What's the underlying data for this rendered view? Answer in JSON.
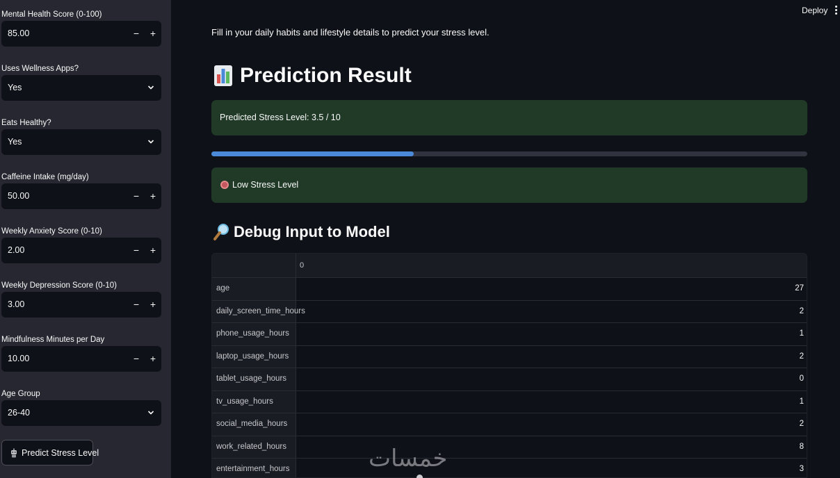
{
  "sidebar": {
    "mental_health": {
      "label": "Mental Health Score (0-100)",
      "value": "85.00"
    },
    "wellness_apps": {
      "label": "Uses Wellness Apps?",
      "value": "Yes"
    },
    "eats_healthy": {
      "label": "Eats Healthy?",
      "value": "Yes"
    },
    "caffeine": {
      "label": "Caffeine Intake (mg/day)",
      "value": "50.00"
    },
    "anxiety": {
      "label": "Weekly Anxiety Score (0-10)",
      "value": "2.00"
    },
    "depression": {
      "label": "Weekly Depression Score (0-10)",
      "value": "3.00"
    },
    "mindfulness": {
      "label": "Mindfulness Minutes per Day",
      "value": "10.00"
    },
    "age_group": {
      "label": "Age Group",
      "value": "26-40"
    },
    "stepper_minus": "−",
    "stepper_plus": "+",
    "predict_button": "Predict Stress Level"
  },
  "header": {
    "deploy": "Deploy"
  },
  "main": {
    "intro": "Fill in your daily habits and lifestyle details to predict your stress level.",
    "result_title": "Prediction Result",
    "predicted_text": "Predicted Stress Level: 3.5 / 10",
    "progress_fraction": 0.34,
    "stress_label": "Low Stress Level",
    "debug_title": "Debug Input to Model",
    "table": {
      "column": "0",
      "rows": [
        {
          "name": "age",
          "value": "27"
        },
        {
          "name": "daily_screen_time_hours",
          "value": "2"
        },
        {
          "name": "phone_usage_hours",
          "value": "1"
        },
        {
          "name": "laptop_usage_hours",
          "value": "2"
        },
        {
          "name": "tablet_usage_hours",
          "value": "0"
        },
        {
          "name": "tv_usage_hours",
          "value": "1"
        },
        {
          "name": "social_media_hours",
          "value": "2"
        },
        {
          "name": "work_related_hours",
          "value": "8"
        },
        {
          "name": "entertainment_hours",
          "value": "3"
        }
      ]
    }
  },
  "watermark": "خمسات",
  "colors": {
    "background": "#0e1117",
    "sidebar": "#262730",
    "success_bg": "#203a27",
    "progress": "#4a8ad8",
    "stress_dot": "#c2575f"
  },
  "icons": {
    "result": "bar-chart-icon",
    "stress": "red-circle-icon",
    "debug": "magnifier-icon",
    "predict": "robot-icon"
  }
}
